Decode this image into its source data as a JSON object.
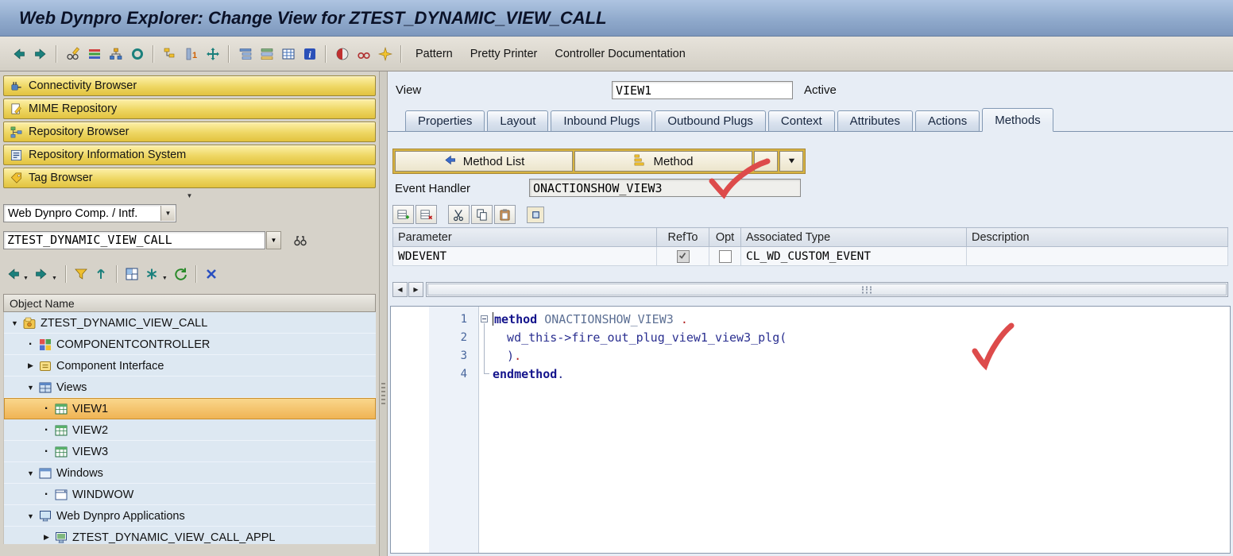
{
  "window": {
    "title": "Web Dynpro Explorer: Change View for ZTEST_DYNAMIC_VIEW_CALL"
  },
  "toolbar": {
    "icon_groups": [
      [
        "back-icon",
        "forward-icon"
      ],
      [
        "display-change-icon",
        "enhancement-icon",
        "hierarchy-icon",
        "where-used-icon"
      ],
      [
        "object-list-icon",
        "version-icon",
        "navigation-icon"
      ],
      [
        "structure-icon",
        "workflow-icon",
        "table-view-icon",
        "info-icon"
      ],
      [
        "check-icon",
        "test-icon",
        "activate-icon"
      ]
    ],
    "text_buttons": [
      "Pattern",
      "Pretty Printer",
      "Controller Documentation"
    ]
  },
  "sidebar": {
    "browsers": [
      {
        "icon": "connectivity-icon",
        "label": "Connectivity Browser"
      },
      {
        "icon": "mime-icon",
        "label": "MIME Repository"
      },
      {
        "icon": "repository-icon",
        "label": "Repository Browser"
      },
      {
        "icon": "infosystem-icon",
        "label": "Repository Information System"
      },
      {
        "icon": "tag-icon",
        "label": "Tag Browser"
      }
    ],
    "category_select": {
      "value": "Web Dynpro Comp. / Intf."
    },
    "object_name_input": {
      "value": "ZTEST_DYNAMIC_VIEW_CALL"
    },
    "find_icon": "binoculars-icon",
    "nav_icons": [
      {
        "icon": "back-icon",
        "dropdown": true
      },
      {
        "icon": "forward-icon",
        "dropdown": true
      },
      {
        "sep": true
      },
      {
        "icon": "filter-icon"
      },
      {
        "icon": "sort-icon"
      },
      {
        "sep": true
      },
      {
        "icon": "layout-icon"
      },
      {
        "icon": "favorites-icon",
        "dropdown": true
      },
      {
        "icon": "refresh-icon"
      },
      {
        "sep": true
      },
      {
        "icon": "close-icon"
      }
    ],
    "tree": {
      "header": "Object Name",
      "items": [
        {
          "level": 0,
          "expander": "open",
          "icon": "component-icon",
          "label": "ZTEST_DYNAMIC_VIEW_CALL",
          "selected": false
        },
        {
          "level": 1,
          "expander": "leaf",
          "icon": "controller-icon",
          "label": "COMPONENTCONTROLLER",
          "selected": false
        },
        {
          "level": 1,
          "expander": "closed",
          "icon": "interface-icon",
          "label": "Component Interface",
          "selected": false
        },
        {
          "level": 1,
          "expander": "open",
          "icon": "views-folder-icon",
          "label": "Views",
          "selected": false
        },
        {
          "level": 2,
          "expander": "leaf",
          "icon": "view-icon",
          "label": "VIEW1",
          "selected": true
        },
        {
          "level": 2,
          "expander": "leaf",
          "icon": "view-icon",
          "label": "VIEW2",
          "selected": false
        },
        {
          "level": 2,
          "expander": "leaf",
          "icon": "view-icon",
          "label": "VIEW3",
          "selected": false
        },
        {
          "level": 1,
          "expander": "open",
          "icon": "windows-folder-icon",
          "label": "Windows",
          "selected": false
        },
        {
          "level": 2,
          "expander": "leaf",
          "icon": "window-icon",
          "label": "WINDWOW",
          "selected": false
        },
        {
          "level": 1,
          "expander": "open",
          "icon": "applications-folder-icon",
          "label": "Web Dynpro Applications",
          "selected": false
        },
        {
          "level": 2,
          "expander": "closed",
          "icon": "application-icon",
          "label": "ZTEST_DYNAMIC_VIEW_CALL_APPL",
          "selected": false
        }
      ]
    }
  },
  "main": {
    "view": {
      "label": "View",
      "value": "VIEW1",
      "status": "Active"
    },
    "tabs": {
      "items": [
        "Properties",
        "Layout",
        "Inbound Plugs",
        "Outbound Plugs",
        "Context",
        "Attributes",
        "Actions",
        "Methods"
      ],
      "active": "Methods"
    },
    "method_bar": {
      "list_button": {
        "icon": "method-list-back-icon",
        "label": "Method List"
      },
      "method_button": {
        "icon": "method-icon",
        "label": "Method"
      },
      "up_button": {
        "icon": "up-triangle-icon"
      },
      "down_button": {
        "icon": "down-triangle-icon"
      }
    },
    "event_handler": {
      "label": "Event Handler",
      "value": "ONACTIONSHOW_VIEW3"
    },
    "edit_toolbar": {
      "groups": [
        [
          "insert-row-icon",
          "delete-row-icon"
        ],
        [
          "cut-icon",
          "copy-icon",
          "paste-icon"
        ],
        [
          "detail-view-icon"
        ]
      ]
    },
    "parameters_table": {
      "columns": [
        "Parameter",
        "RefTo",
        "Opt",
        "Associated Type",
        "Description"
      ],
      "rows": [
        {
          "parameter": "WDEVENT",
          "refto": true,
          "opt": false,
          "associated_type": "CL_WD_CUSTOM_EVENT",
          "description": ""
        }
      ]
    },
    "code_editor": {
      "lines": [
        {
          "num": "1",
          "fold": "collapse",
          "caret": true,
          "segments": [
            {
              "text": "method",
              "style": "keyword"
            },
            {
              "text": " ONACTIONSHOW_VIEW3 ",
              "style": "ident"
            },
            {
              "text": ".",
              "style": "dot"
            }
          ]
        },
        {
          "num": "2",
          "fold": "line",
          "segments": [
            {
              "text": "  wd_this->fire_out_plug_view1_view3_plg(",
              "style": "code"
            }
          ]
        },
        {
          "num": "3",
          "fold": "line",
          "segments": [
            {
              "text": "  )",
              "style": "code"
            },
            {
              "text": ".",
              "style": "dot"
            }
          ]
        },
        {
          "num": "4",
          "fold": "end",
          "segments": [
            {
              "text": "endmethod",
              "style": "keyword"
            },
            {
              "text": ".",
              "style": "code"
            }
          ]
        }
      ]
    },
    "annotations": {
      "checkmark_color": "#dd4b4b",
      "checkmarks": [
        "event-handler-field",
        "code-editor"
      ]
    }
  }
}
